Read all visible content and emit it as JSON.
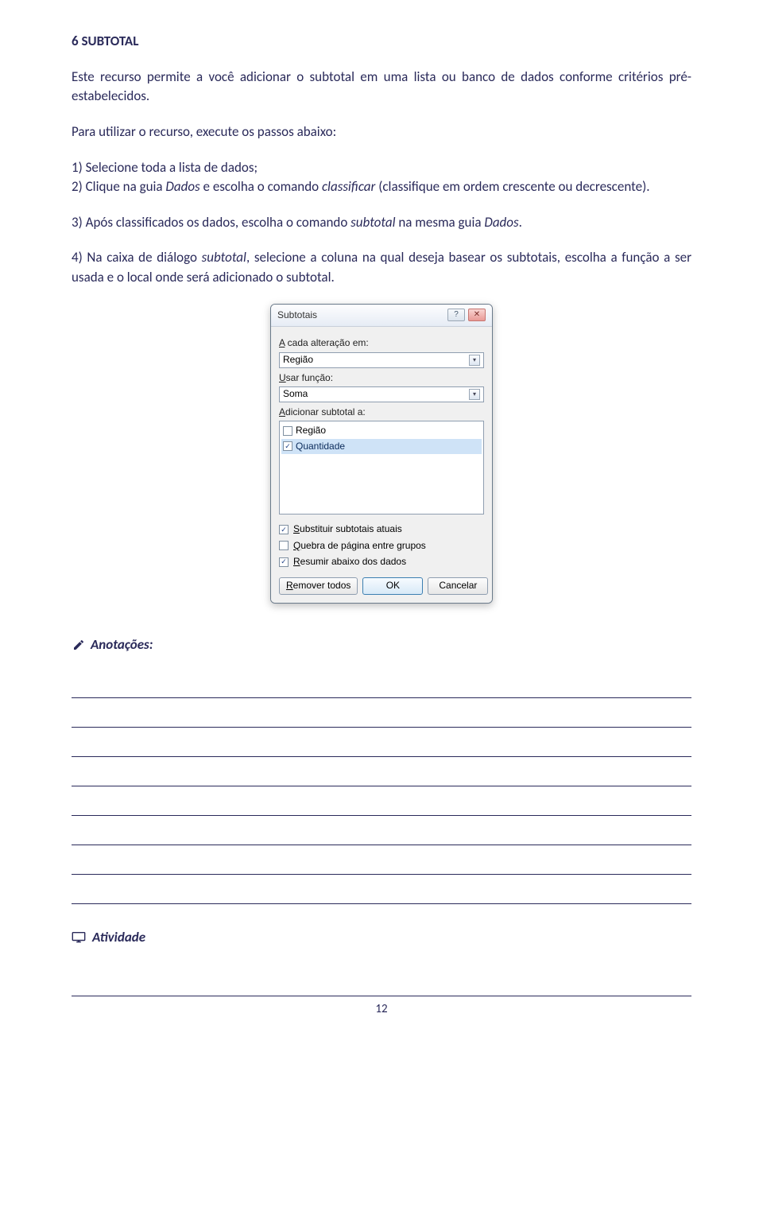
{
  "heading": "6 SUBTOTAL",
  "p1": "Este recurso permite a você adicionar o subtotal em uma lista ou banco de dados conforme critérios pré-estabelecidos.",
  "p2": "Para utilizar o recurso, execute os passos abaixo:",
  "p3_a": "1) Selecione toda a lista de dados;",
  "p3_b_pre": "2) Clique na guia ",
  "p3_b_i1": "Dados",
  "p3_b_mid": " e escolha o comando ",
  "p3_b_i2": "classificar",
  "p3_b_post": " (classifique em ordem crescente ou decrescente).",
  "p4_pre": "3) Após classificados os dados, escolha o comando ",
  "p4_i1": "subtotal",
  "p4_mid": " na mesma guia ",
  "p4_i2": "Dados",
  "p4_post": ".",
  "p5_pre": "4) Na caixa de diálogo ",
  "p5_i1": "subtotal",
  "p5_post": ", selecione a coluna na qual deseja basear os subtotais, escolha a função a ser usada e o local onde será adicionado o subtotal.",
  "dialog": {
    "title": "Subtotais",
    "lbl_change_pre": "A",
    "lbl_change_post": " cada alteração em:",
    "field_change": "Região",
    "lbl_func_pre": "U",
    "lbl_func_post": "sar função:",
    "field_func": "Soma",
    "lbl_add_pre": "A",
    "lbl_add_post": "dicionar subtotal a:",
    "list_item1": "Região",
    "list_item2": "Quantidade",
    "chk1_pre": "S",
    "chk1_post": "ubstituir subtotais atuais",
    "chk2_pre": "Q",
    "chk2_post": "uebra de página entre grupos",
    "chk3_pre": "R",
    "chk3_post": "esumir abaixo dos dados",
    "btn_remove_pre": "R",
    "btn_remove_post": "emover todos",
    "btn_ok": "OK",
    "btn_cancel": "Cancelar"
  },
  "annot_label": "Anotações:",
  "activity_label": "Atividade",
  "page_number": "12"
}
